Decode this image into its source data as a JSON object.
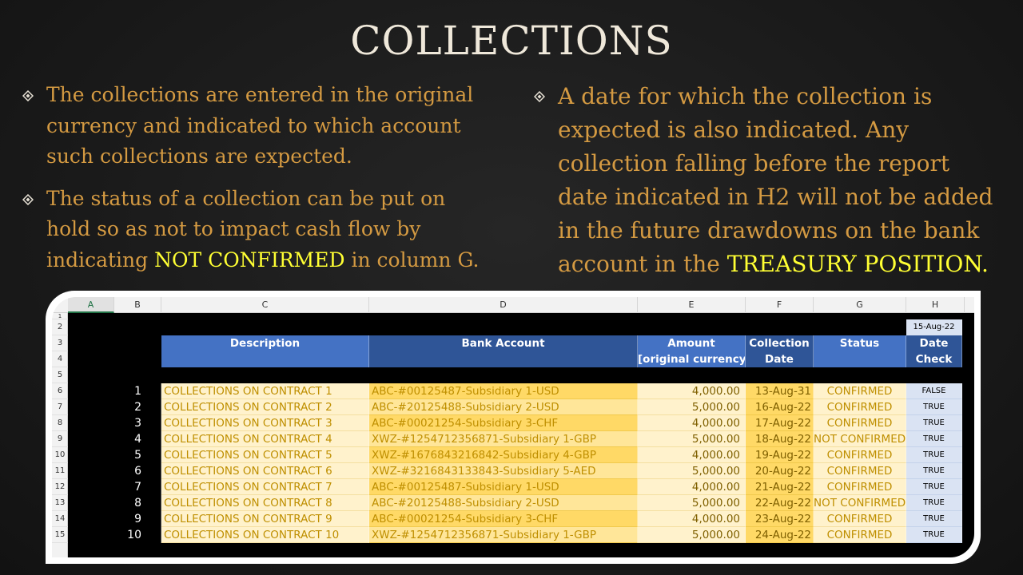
{
  "slide": {
    "title": "COLLECTIONS",
    "left_bullets": [
      {
        "parts": [
          {
            "text": "The collections are entered in the original currency and indicated to which account such collections are expected.",
            "hl": false
          }
        ]
      },
      {
        "parts": [
          {
            "text": "The status of a collection can be put on hold so as not to impact cash flow by indicating ",
            "hl": false
          },
          {
            "text": "NOT CONFIRMED",
            "hl": true
          },
          {
            "text": " in column G.",
            "hl": false
          }
        ]
      }
    ],
    "right_bullets": [
      {
        "parts": [
          {
            "text": "A date for which the collection is expected is also indicated.  Any collection falling before the report date indicated in H2 will not be added in the future drawdowns on the bank account in the ",
            "hl": false
          },
          {
            "text": "TREASURY POSITION.",
            "hl": true
          }
        ]
      }
    ]
  },
  "sheet": {
    "column_letters": [
      "A",
      "B",
      "C",
      "D",
      "E",
      "F",
      "G",
      "H"
    ],
    "selected_column": "A",
    "row_numbers": [
      "1",
      "2",
      "3",
      "4",
      "5",
      "6",
      "7",
      "8",
      "9",
      "10",
      "11",
      "12",
      "13",
      "14",
      "15"
    ],
    "report_date": "15-Aug-22",
    "headers": {
      "description": "Description",
      "bank_account": "Bank Account",
      "amount_line1": "Amount",
      "amount_line2": "[original currency]",
      "collection_line1": "Collection",
      "collection_line2": "Date",
      "status": "Status",
      "datecheck_line1": "Date",
      "datecheck_line2": "Check"
    },
    "rows": [
      {
        "no": "1",
        "description": "COLLECTIONS ON CONTRACT 1",
        "bank": "ABC-#00125487-Subsidiary 1-USD",
        "amount": "4,000.00",
        "date": "13-Aug-31",
        "status": "CONFIRMED",
        "check": "FALSE"
      },
      {
        "no": "2",
        "description": "COLLECTIONS ON CONTRACT 2",
        "bank": "ABC-#20125488-Subsidiary 2-USD",
        "amount": "5,000.00",
        "date": "16-Aug-22",
        "status": "CONFIRMED",
        "check": "TRUE"
      },
      {
        "no": "3",
        "description": "COLLECTIONS ON CONTRACT 3",
        "bank": "ABC-#00021254-Subsidiary 3-CHF",
        "amount": "4,000.00",
        "date": "17-Aug-22",
        "status": "CONFIRMED",
        "check": "TRUE"
      },
      {
        "no": "4",
        "description": "COLLECTIONS ON CONTRACT 4",
        "bank": "XWZ-#1254712356871-Subsidiary 1-GBP",
        "amount": "5,000.00",
        "date": "18-Aug-22",
        "status": "NOT CONFIRMED",
        "check": "TRUE"
      },
      {
        "no": "5",
        "description": "COLLECTIONS ON CONTRACT 5",
        "bank": "XWZ-#1676843216842-Subsidiary 4-GBP",
        "amount": "4,000.00",
        "date": "19-Aug-22",
        "status": "CONFIRMED",
        "check": "TRUE"
      },
      {
        "no": "6",
        "description": "COLLECTIONS ON CONTRACT 6",
        "bank": "XWZ-#3216843133843-Subsidiary 5-AED",
        "amount": "5,000.00",
        "date": "20-Aug-22",
        "status": "CONFIRMED",
        "check": "TRUE"
      },
      {
        "no": "7",
        "description": "COLLECTIONS ON CONTRACT 7",
        "bank": "ABC-#00125487-Subsidiary 1-USD",
        "amount": "4,000.00",
        "date": "21-Aug-22",
        "status": "CONFIRMED",
        "check": "TRUE"
      },
      {
        "no": "8",
        "description": "COLLECTIONS ON CONTRACT 8",
        "bank": "ABC-#20125488-Subsidiary 2-USD",
        "amount": "5,000.00",
        "date": "22-Aug-22",
        "status": "NOT CONFIRMED",
        "check": "TRUE"
      },
      {
        "no": "9",
        "description": "COLLECTIONS ON CONTRACT 9",
        "bank": "ABC-#00021254-Subsidiary 3-CHF",
        "amount": "4,000.00",
        "date": "23-Aug-22",
        "status": "CONFIRMED",
        "check": "TRUE"
      },
      {
        "no": "10",
        "description": "COLLECTIONS ON CONTRACT 10",
        "bank": "XWZ-#1254712356871-Subsidiary 1-GBP",
        "amount": "5,000.00",
        "date": "24-Aug-22",
        "status": "CONFIRMED",
        "check": "TRUE"
      }
    ],
    "colors": {
      "header_blue": "#4472c4",
      "header_dark_blue": "#2f5597",
      "cream": "#fff2cc",
      "gold": "#ffd966",
      "check_blue": "#dae3f3"
    }
  }
}
